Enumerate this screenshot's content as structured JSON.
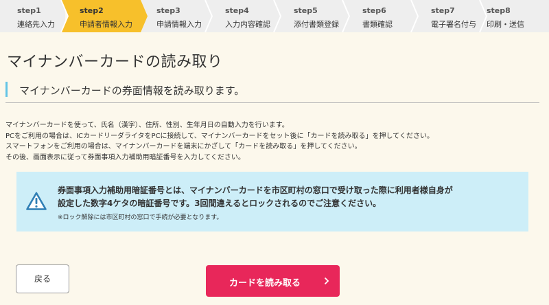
{
  "steps": [
    {
      "num": "step1",
      "name": "連絡先入力"
    },
    {
      "num": "step2",
      "name": "申請者情報入力"
    },
    {
      "num": "step3",
      "name": "申請情報入力"
    },
    {
      "num": "step4",
      "name": "入力内容確認"
    },
    {
      "num": "step5",
      "name": "添付書類登録"
    },
    {
      "num": "step6",
      "name": "書類確認"
    },
    {
      "num": "step7",
      "name": "電子署名付与"
    },
    {
      "num": "step8",
      "name": "印刷・送信"
    }
  ],
  "active_step": 2,
  "page": {
    "title": "マイナンバーカードの読み取り",
    "section_title": "マイナンバーカードの券面情報を読み取ります。",
    "description": [
      "マイナンバーカードを使って、氏名（漢字）、住所、性別、生年月日の自動入力を行います。",
      "PCをご利用の場合は、ICカードリーダライタをPCに接続して、マイナンバーカードをセット後に「カードを読み取る」を押してください。",
      "スマートフォンをご利用の場合は、マイナンバーカードを端末にかざして「カードを読み取る」を押してください。",
      "その後、画面表示に従って券面事項入力補助用暗証番号を入力してください。"
    ]
  },
  "notice": {
    "line1": "券面事項入力補助用暗証番号とは、マイナンバーカードを市区町村の窓口で受け取った際に利用者様自身が",
    "line2": "設定した数字4ケタの暗証番号です。3回間違えるとロックされるのでご注意ください。",
    "sub": "※ロック解除には市区町村の窓口で手続が必要となります。"
  },
  "buttons": {
    "back": "戻る",
    "read_card": "カードを読み取る"
  },
  "colors": {
    "active_step": "#f7c02b",
    "accent_bar": "#62c4e6",
    "notice_bg": "#cdeef8",
    "primary_button": "#e8275a",
    "page_bg": "#fcf8ec"
  },
  "icons": {
    "notice": "warning-icon",
    "read_button": "chevron-right-icon"
  }
}
